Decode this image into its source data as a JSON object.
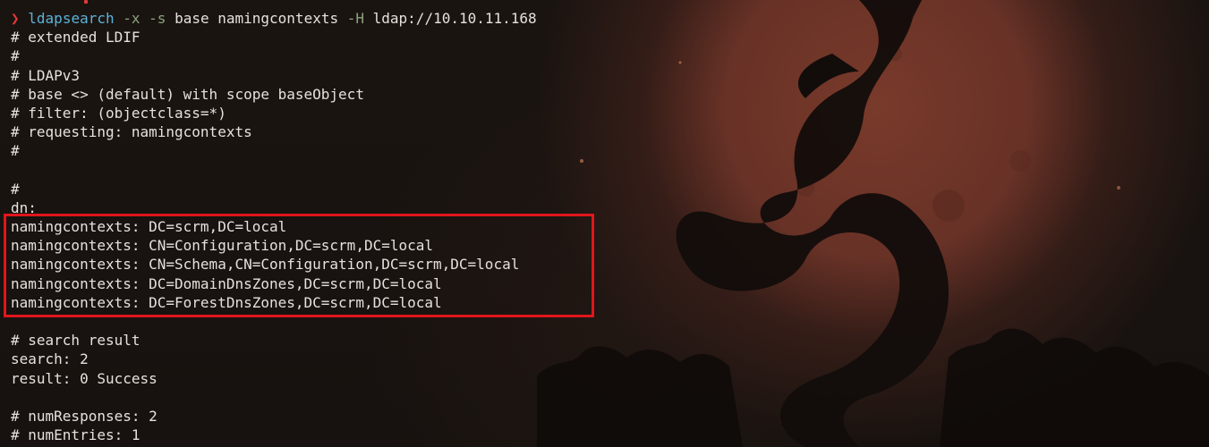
{
  "colors": {
    "background": "#17120f",
    "moon": "#7e3c2c",
    "text": "#e6e1dc",
    "command": "#5bb2d8",
    "flag": "#8aa37a",
    "prompt_arrow": "#e53935",
    "highlight_border": "#e0161b"
  },
  "icons": {
    "prompt": "chevron-right-icon",
    "background_art": "dragon-moon-wallpaper"
  },
  "command": {
    "prompt_symbol": "❯",
    "program": "ldapsearch",
    "flag_x": "-x",
    "flag_s": "-s",
    "scope": "base",
    "attribute": "namingcontexts",
    "flag_h": "-H",
    "uri": "ldap://10.10.11.168"
  },
  "output": {
    "header": [
      "# extended LDIF",
      "#",
      "# LDAPv3",
      "# base <> (default) with scope baseObject",
      "# filter: (objectclass=*)",
      "# requesting: namingcontexts",
      "#",
      "",
      "#",
      "dn:"
    ],
    "naming_contexts": [
      "namingcontexts: DC=scrm,DC=local",
      "namingcontexts: CN=Configuration,DC=scrm,DC=local",
      "namingcontexts: CN=Schema,CN=Configuration,DC=scrm,DC=local",
      "namingcontexts: DC=DomainDnsZones,DC=scrm,DC=local",
      "namingcontexts: DC=ForestDnsZones,DC=scrm,DC=local"
    ],
    "footer": [
      "",
      "# search result",
      "search: 2",
      "result: 0 Success",
      "",
      "# numResponses: 2",
      "# numEntries: 1"
    ]
  }
}
